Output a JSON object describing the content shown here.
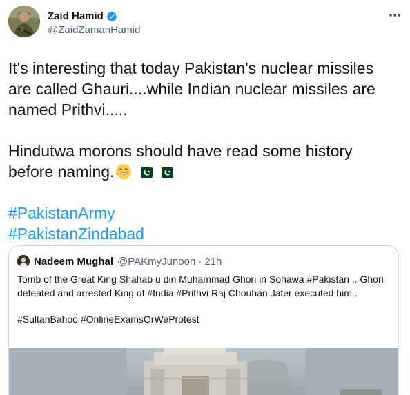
{
  "author": {
    "display_name": "Zaid Hamid",
    "handle": "@ZaidZamanHamid",
    "verified": true
  },
  "icons": {
    "more": "more-horizontal-icon",
    "verified": "verified-badge-icon",
    "emoji": "grinning-face-icon",
    "flag": "pakistan-flag-icon"
  },
  "tweet": {
    "paragraph1": "It's interesting that today Pakistan's nuclear missiles are called Ghauri....while Indian nuclear missiles are named Prithvi.....",
    "paragraph2": "Hindutwa morons should have read some history before naming.",
    "hashtags": [
      "#PakistanArmy",
      "#PakistanZindabad"
    ]
  },
  "quoted_tweet": {
    "display_name": "Nadeem Mughal",
    "handle": "@PAKmyJunoon",
    "separator": "·",
    "time": "21h",
    "text1": "Tomb of the Great King Shahab u din Muhammad Ghori in Sohawa #Pakistan .. Ghori defeated and arrested King of #India #Prithvi Raj Chouhan..later executed him..",
    "text2": "#SultanBahoo #OnlineExamsOrWeProtest"
  },
  "colors": {
    "link": "#1d9bf0",
    "secondary_text": "#536471",
    "border": "#cfd9de",
    "verified": "#1d9bf0"
  }
}
